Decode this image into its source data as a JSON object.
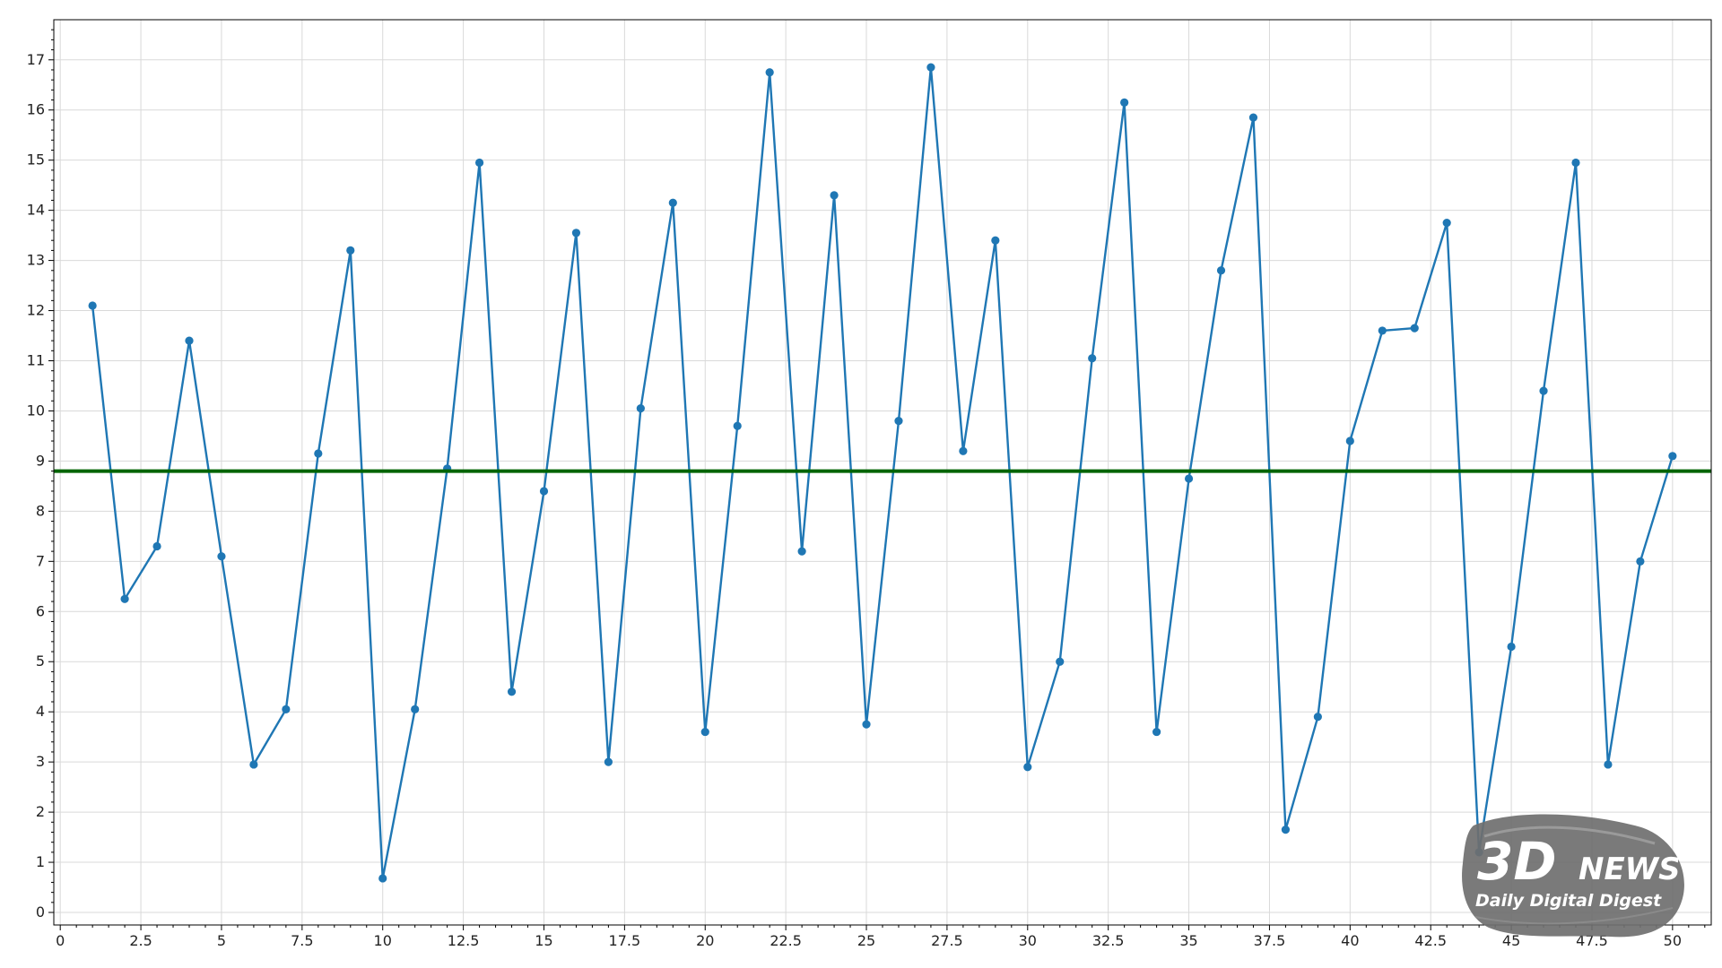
{
  "chart_data": {
    "type": "line",
    "title": "",
    "xlabel": "",
    "ylabel": "",
    "xlim": [
      -0.2,
      51.2
    ],
    "ylim": [
      -0.25,
      17.8
    ],
    "xticks": [
      0,
      2.5,
      5,
      7.5,
      10,
      12.5,
      15,
      17.5,
      20,
      22.5,
      25,
      27.5,
      30,
      32.5,
      35,
      37.5,
      40,
      42.5,
      45,
      47.5,
      50
    ],
    "xtick_labels": [
      "0",
      "2.5",
      "5",
      "7.5",
      "10",
      "12.5",
      "15",
      "17.5",
      "20",
      "22.5",
      "25",
      "27.5",
      "30",
      "32.5",
      "35",
      "37.5",
      "40",
      "42.5",
      "45",
      "47.5",
      "50"
    ],
    "yticks": [
      0,
      1,
      2,
      3,
      4,
      5,
      6,
      7,
      8,
      9,
      10,
      11,
      12,
      13,
      14,
      15,
      16,
      17
    ],
    "ytick_labels": [
      "0",
      "1",
      "2",
      "3",
      "4",
      "5",
      "6",
      "7",
      "8",
      "9",
      "10",
      "11",
      "12",
      "13",
      "14",
      "15",
      "16",
      "17"
    ],
    "grid": true,
    "minor_ticks": true,
    "series": [
      {
        "color": "#1f77b4",
        "markers": true,
        "x": [
          1,
          2,
          3,
          4,
          5,
          6,
          7,
          8,
          9,
          10,
          11,
          12,
          13,
          14,
          15,
          16,
          17,
          18,
          19,
          20,
          21,
          22,
          23,
          24,
          25,
          26,
          27,
          28,
          29,
          30,
          31,
          32,
          33,
          34,
          35,
          36,
          37,
          38,
          39,
          40,
          41,
          42,
          43,
          44,
          45,
          46,
          47,
          48,
          49,
          50
        ],
        "y": [
          12.1,
          6.25,
          7.3,
          11.4,
          7.1,
          2.95,
          4.05,
          9.15,
          13.2,
          0.68,
          4.05,
          8.85,
          14.95,
          4.4,
          8.4,
          13.55,
          3.0,
          10.05,
          14.15,
          3.6,
          9.7,
          16.75,
          7.2,
          14.3,
          3.75,
          9.8,
          16.85,
          9.2,
          13.4,
          2.9,
          5.0,
          11.05,
          16.15,
          3.6,
          8.65,
          12.8,
          15.85,
          1.65,
          3.9,
          9.4,
          11.6,
          11.65,
          13.75,
          1.2,
          5.3,
          10.4,
          14.95,
          2.95,
          7.0,
          9.1
        ]
      }
    ],
    "reference_line": {
      "y": 8.8,
      "color": "#006400"
    }
  },
  "watermark": {
    "brand": "3D",
    "brand_suffix": "NEWS",
    "tagline": "Daily Digital Digest"
  }
}
